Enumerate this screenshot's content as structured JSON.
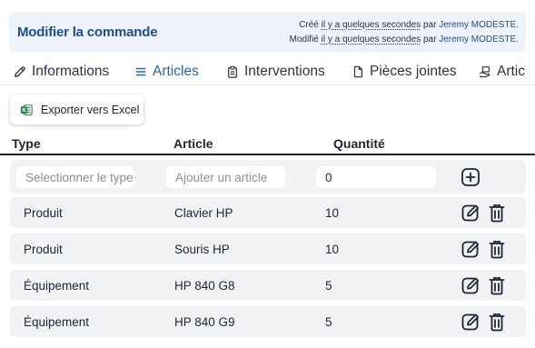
{
  "header": {
    "title": "Modifier la commande",
    "created_prefix": "Créé",
    "created_rel": "il y a quelques secondes",
    "created_by_prefix": "par",
    "created_user": "Jeremy MODESTE.",
    "modified_prefix": "Modifié",
    "modified_rel": "il y a quelques secondes",
    "modified_by_prefix": "par",
    "modified_user": "Jeremy MODESTE."
  },
  "tabs": [
    {
      "label": "Informations",
      "icon": "edit-icon"
    },
    {
      "label": "Articles",
      "icon": "list-icon",
      "active": true
    },
    {
      "label": "Interventions",
      "icon": "clipboard-icon"
    },
    {
      "label": "Pièces jointes",
      "icon": "file-icon"
    },
    {
      "label": "Artic",
      "icon": "box-hand-icon"
    }
  ],
  "toolbar": {
    "export_label": "Exporter vers Excel",
    "export_icon": "excel-icon",
    "excel_color": "#1d7a45"
  },
  "table": {
    "headers": {
      "type": "Type",
      "article": "Article",
      "quantity": "Quantité"
    },
    "new_row": {
      "type_placeholder": "Selectionner le type",
      "article_placeholder": "Ajouter un article",
      "quantity_value": "0"
    },
    "rows": [
      {
        "type": "Produit",
        "article": "Clavier HP",
        "quantity": "10"
      },
      {
        "type": "Produit",
        "article": "Souris HP",
        "quantity": "10"
      },
      {
        "type": "Équipement",
        "article": "HP 840 G8",
        "quantity": "5"
      },
      {
        "type": "Équipement",
        "article": "HP 840 G9",
        "quantity": "5"
      }
    ]
  },
  "colors": {
    "accent": "#2b62a8",
    "title": "#1e4f8a",
    "header_bg": "#eef3fa",
    "row_bg": "#f1f2f4"
  }
}
